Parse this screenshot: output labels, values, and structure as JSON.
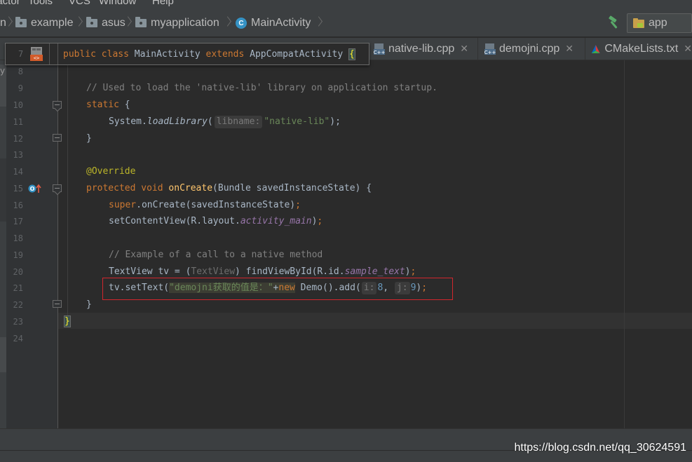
{
  "menu": [
    {
      "label": "Refactor"
    },
    {
      "label": "Tools"
    },
    {
      "label": "VCS"
    },
    {
      "label": "Window"
    },
    {
      "label": "Help"
    }
  ],
  "breadcrumb": {
    "cut": "n",
    "items": [
      "example",
      "asus",
      "myapplication",
      "MainActivity"
    ],
    "class_badge": "C"
  },
  "run_config": {
    "label": "app"
  },
  "tabs": [
    {
      "label": "native-lib.cpp",
      "icon": "cpp-file-icon"
    },
    {
      "label": "demojni.cpp",
      "icon": "cpp-file-icon"
    },
    {
      "label": "CMakeLists.txt",
      "icon": "cmake-icon"
    }
  ],
  "left_panel_label": "y",
  "sticky": {
    "line": "7",
    "kw1": "public",
    "kw2": "class",
    "name": "MainActivity",
    "kw3": "extends",
    "parent": "AppCompatActivity",
    "brace": "{"
  },
  "lines": {
    "n8": "8",
    "n9": "9",
    "n10": "10",
    "n11": "11",
    "n12": "12",
    "n13": "13",
    "n14": "14",
    "n15": "15",
    "n16": "16",
    "n17": "17",
    "n18": "18",
    "n19": "19",
    "n20": "20",
    "n21": "21",
    "n22": "22",
    "n23": "23",
    "n24": "24"
  },
  "code": {
    "l9_comment": "// Used to load the 'native-lib' library on application startup.",
    "l10_static": "static",
    "l10_brace": " {",
    "l11_system": "System.",
    "l11_method": "loadLibrary",
    "l11_paren": "(",
    "l11_hint": "libname:",
    "l11_str": "\"native-lib\"",
    "l11_end": ");",
    "l12": "}",
    "l14_annotation": "@Override",
    "l15_protected": "protected",
    "l15_void": "void",
    "l15_method": "onCreate",
    "l15_rest": "(Bundle savedInstanceState) {",
    "l16_super": "super",
    "l16_rest": ".onCreate(savedInstanceState)",
    "l16_semi": ";",
    "l17_a": "setContentView(R.layout.",
    "l17_field": "activity_main",
    "l17_b": ")",
    "l17_semi": ";",
    "l19_comment": "// Example of a call to a native method",
    "l20_a": "TextView tv = (",
    "l20_cast": "TextView",
    "l20_b": ") findViewById(R.id.",
    "l20_field": "sample_text",
    "l20_c": ")",
    "l20_semi": ";",
    "l21_a": "tv.setText(",
    "l21_str": "\"demojni获取的值是：\"",
    "l21_plus": "+",
    "l21_new": "new",
    "l21_b": " Demo().add(",
    "l21_hint_i": "i:",
    "l21_i": "8",
    "l21_comma": ", ",
    "l21_hint_j": "j:",
    "l21_j": "9",
    "l21_c": ")",
    "l21_semi": ";",
    "l22": "}",
    "l23": "}"
  },
  "watermark": "https://blog.csdn.net/qq_30624591",
  "colors": {
    "keyword": "#cc7832",
    "string": "#6a8759",
    "number": "#6897bb",
    "comment": "#808080",
    "method_decl": "#ffc66d",
    "annotation": "#bbb529",
    "field": "#9876aa",
    "highlight_box": "#d2262d"
  }
}
